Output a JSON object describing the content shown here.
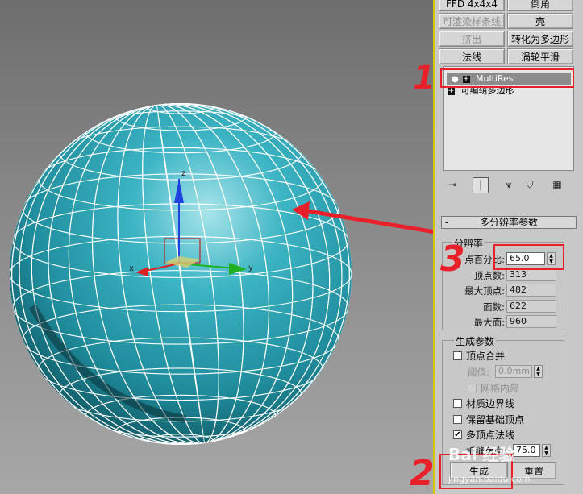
{
  "modifier_buttons": {
    "row0": [
      "FFD 4x4x4",
      "倒角"
    ],
    "row1": [
      "可渲染样条线",
      "壳"
    ],
    "row2": [
      "挤出",
      "转化为多边形"
    ],
    "row3": [
      "法线",
      "涡轮平滑"
    ]
  },
  "stack": {
    "items": [
      "MultiRes",
      "可编辑多边形"
    ],
    "selected": "MultiRes",
    "item_icons": [
      "bulb-icon",
      "plus-box-icon"
    ]
  },
  "stack_tools": [
    "pin-stack-icon",
    "show-end-result-icon",
    "make-unique-icon",
    "remove-modifier-icon",
    "configure-sets-icon"
  ],
  "rollout": {
    "collapse": "-",
    "title": "多分辨率参数"
  },
  "resolution": {
    "group_title": "分辨率",
    "percent_label": "点百分比:",
    "percent_value": "65.0",
    "vertex_count_label": "顶点数:",
    "vertex_count_value": "313",
    "max_vertex_label": "最大顶点:",
    "max_vertex_value": "482",
    "face_count_label": "面数:",
    "face_count_value": "622",
    "max_face_label": "最大面:",
    "max_face_value": "960"
  },
  "generation": {
    "group_title": "生成参数",
    "merge_vertices_label": "顶点合并",
    "merge_vertices_checked": false,
    "threshold_label": "阈值:",
    "threshold_value": "0.0mm",
    "mesh_inside_label": "网格内部",
    "mesh_inside_checked": false,
    "material_boundary_label": "材质边界线",
    "material_boundary_checked": false,
    "keep_base_vertices_label": "保留基础顶点",
    "keep_base_vertices_checked": false,
    "multi_vertex_normals_label": "多顶点法线",
    "multi_vertex_normals_checked": true,
    "crease_angle_label": "折缝角度:",
    "crease_angle_value": "75.0",
    "generate_button": "生成",
    "reset_button": "重置"
  },
  "annotations": {
    "step1": "1",
    "step2": "2",
    "step3": "3",
    "color": "#e8202a"
  },
  "watermark": {
    "brand": "Bai 经验",
    "url": "jingyan.baidu.com"
  },
  "viewport": {
    "sphere_color": "#2ea3b4",
    "gizmo_axis_colors": {
      "x": "#e02020",
      "y": "#20b020",
      "z": "#2040e0"
    }
  }
}
